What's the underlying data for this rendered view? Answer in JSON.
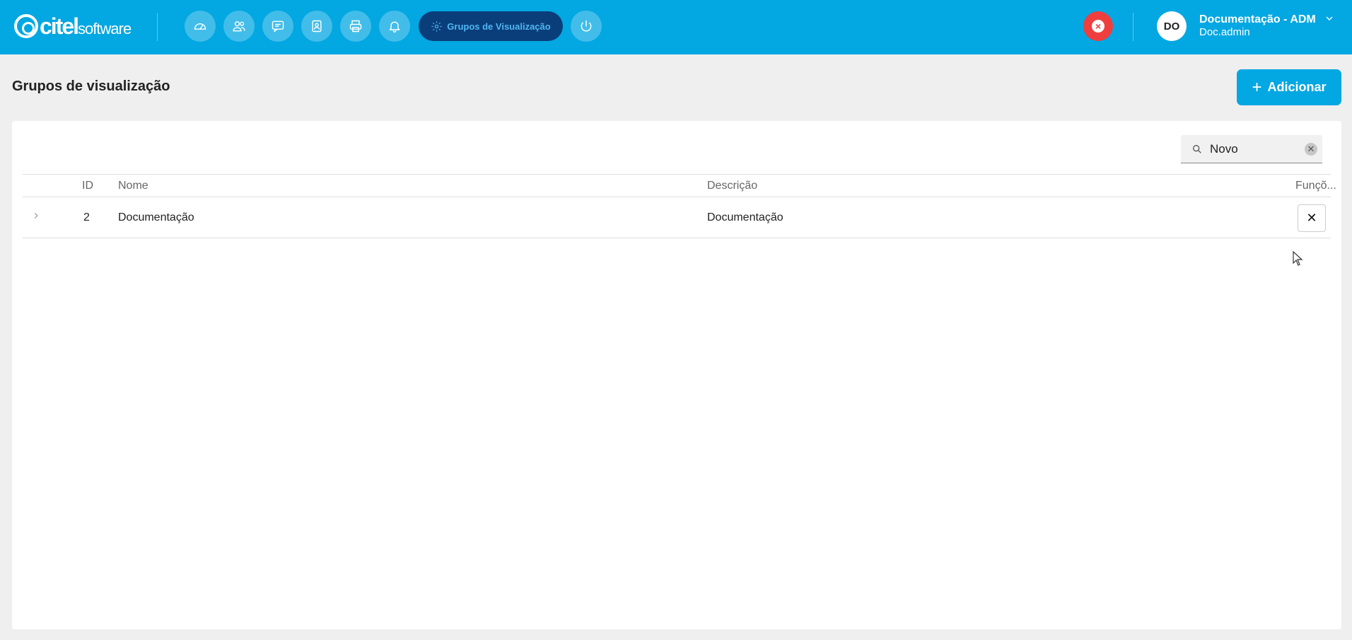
{
  "brand": {
    "name": "citel",
    "suffix": "software"
  },
  "nav": {
    "active_label": "Grupos de Visualização",
    "icons": [
      "dashboard-icon",
      "users-icon",
      "chat-icon",
      "contact-icon",
      "printer-icon",
      "bell-icon",
      "gear-icon",
      "power-icon"
    ]
  },
  "user": {
    "initials": "DO",
    "name": "Documentação - ADM",
    "login": "Doc.admin"
  },
  "page": {
    "title": "Grupos de visualização",
    "add_label": "Adicionar",
    "add_symbol": "+"
  },
  "search": {
    "value": "Novo",
    "clear_symbol": "✕"
  },
  "table": {
    "headers": {
      "id": "ID",
      "nome": "Nome",
      "descricao": "Descrição",
      "funcoes": "Funçõ..."
    },
    "rows": [
      {
        "id": "2",
        "nome": "Documentação",
        "descricao": "Documentação",
        "action": "✕"
      }
    ]
  },
  "colors": {
    "primary": "#03a7e2",
    "active_nav": "#0a3e7a",
    "danger": "#ef3e3e"
  }
}
